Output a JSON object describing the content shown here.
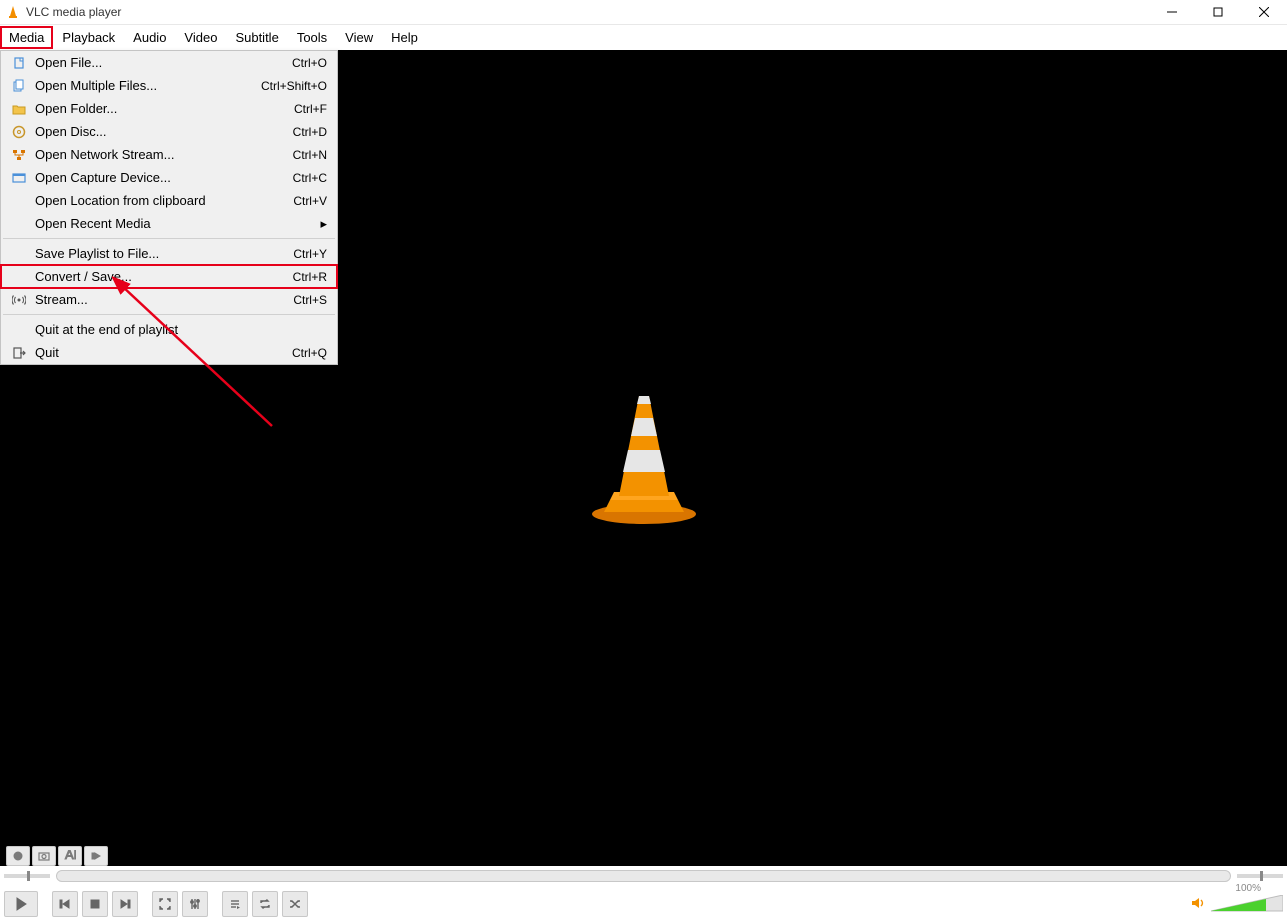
{
  "title": "VLC media player",
  "menubar": [
    "Media",
    "Playback",
    "Audio",
    "Video",
    "Subtitle",
    "Tools",
    "View",
    "Help"
  ],
  "menu_highlight_index": 0,
  "dropdown": {
    "groups": [
      [
        {
          "icon": "file",
          "label": "Open File...",
          "shortcut": "Ctrl+O"
        },
        {
          "icon": "files",
          "label": "Open Multiple Files...",
          "shortcut": "Ctrl+Shift+O"
        },
        {
          "icon": "folder",
          "label": "Open Folder...",
          "shortcut": "Ctrl+F"
        },
        {
          "icon": "disc",
          "label": "Open Disc...",
          "shortcut": "Ctrl+D"
        },
        {
          "icon": "network",
          "label": "Open Network Stream...",
          "shortcut": "Ctrl+N"
        },
        {
          "icon": "capture",
          "label": "Open Capture Device...",
          "shortcut": "Ctrl+C"
        },
        {
          "icon": "",
          "label": "Open Location from clipboard",
          "shortcut": "Ctrl+V"
        },
        {
          "icon": "",
          "label": "Open Recent Media",
          "shortcut": "",
          "submenu": true
        }
      ],
      [
        {
          "icon": "",
          "label": "Save Playlist to File...",
          "shortcut": "Ctrl+Y"
        },
        {
          "icon": "",
          "label": "Convert / Save...",
          "shortcut": "Ctrl+R",
          "boxed": true
        },
        {
          "icon": "stream",
          "label": "Stream...",
          "shortcut": "Ctrl+S"
        }
      ],
      [
        {
          "icon": "",
          "label": "Quit at the end of playlist",
          "shortcut": ""
        },
        {
          "icon": "quit",
          "label": "Quit",
          "shortcut": "Ctrl+Q"
        }
      ]
    ]
  },
  "volume": {
    "percent_label": "100%"
  }
}
